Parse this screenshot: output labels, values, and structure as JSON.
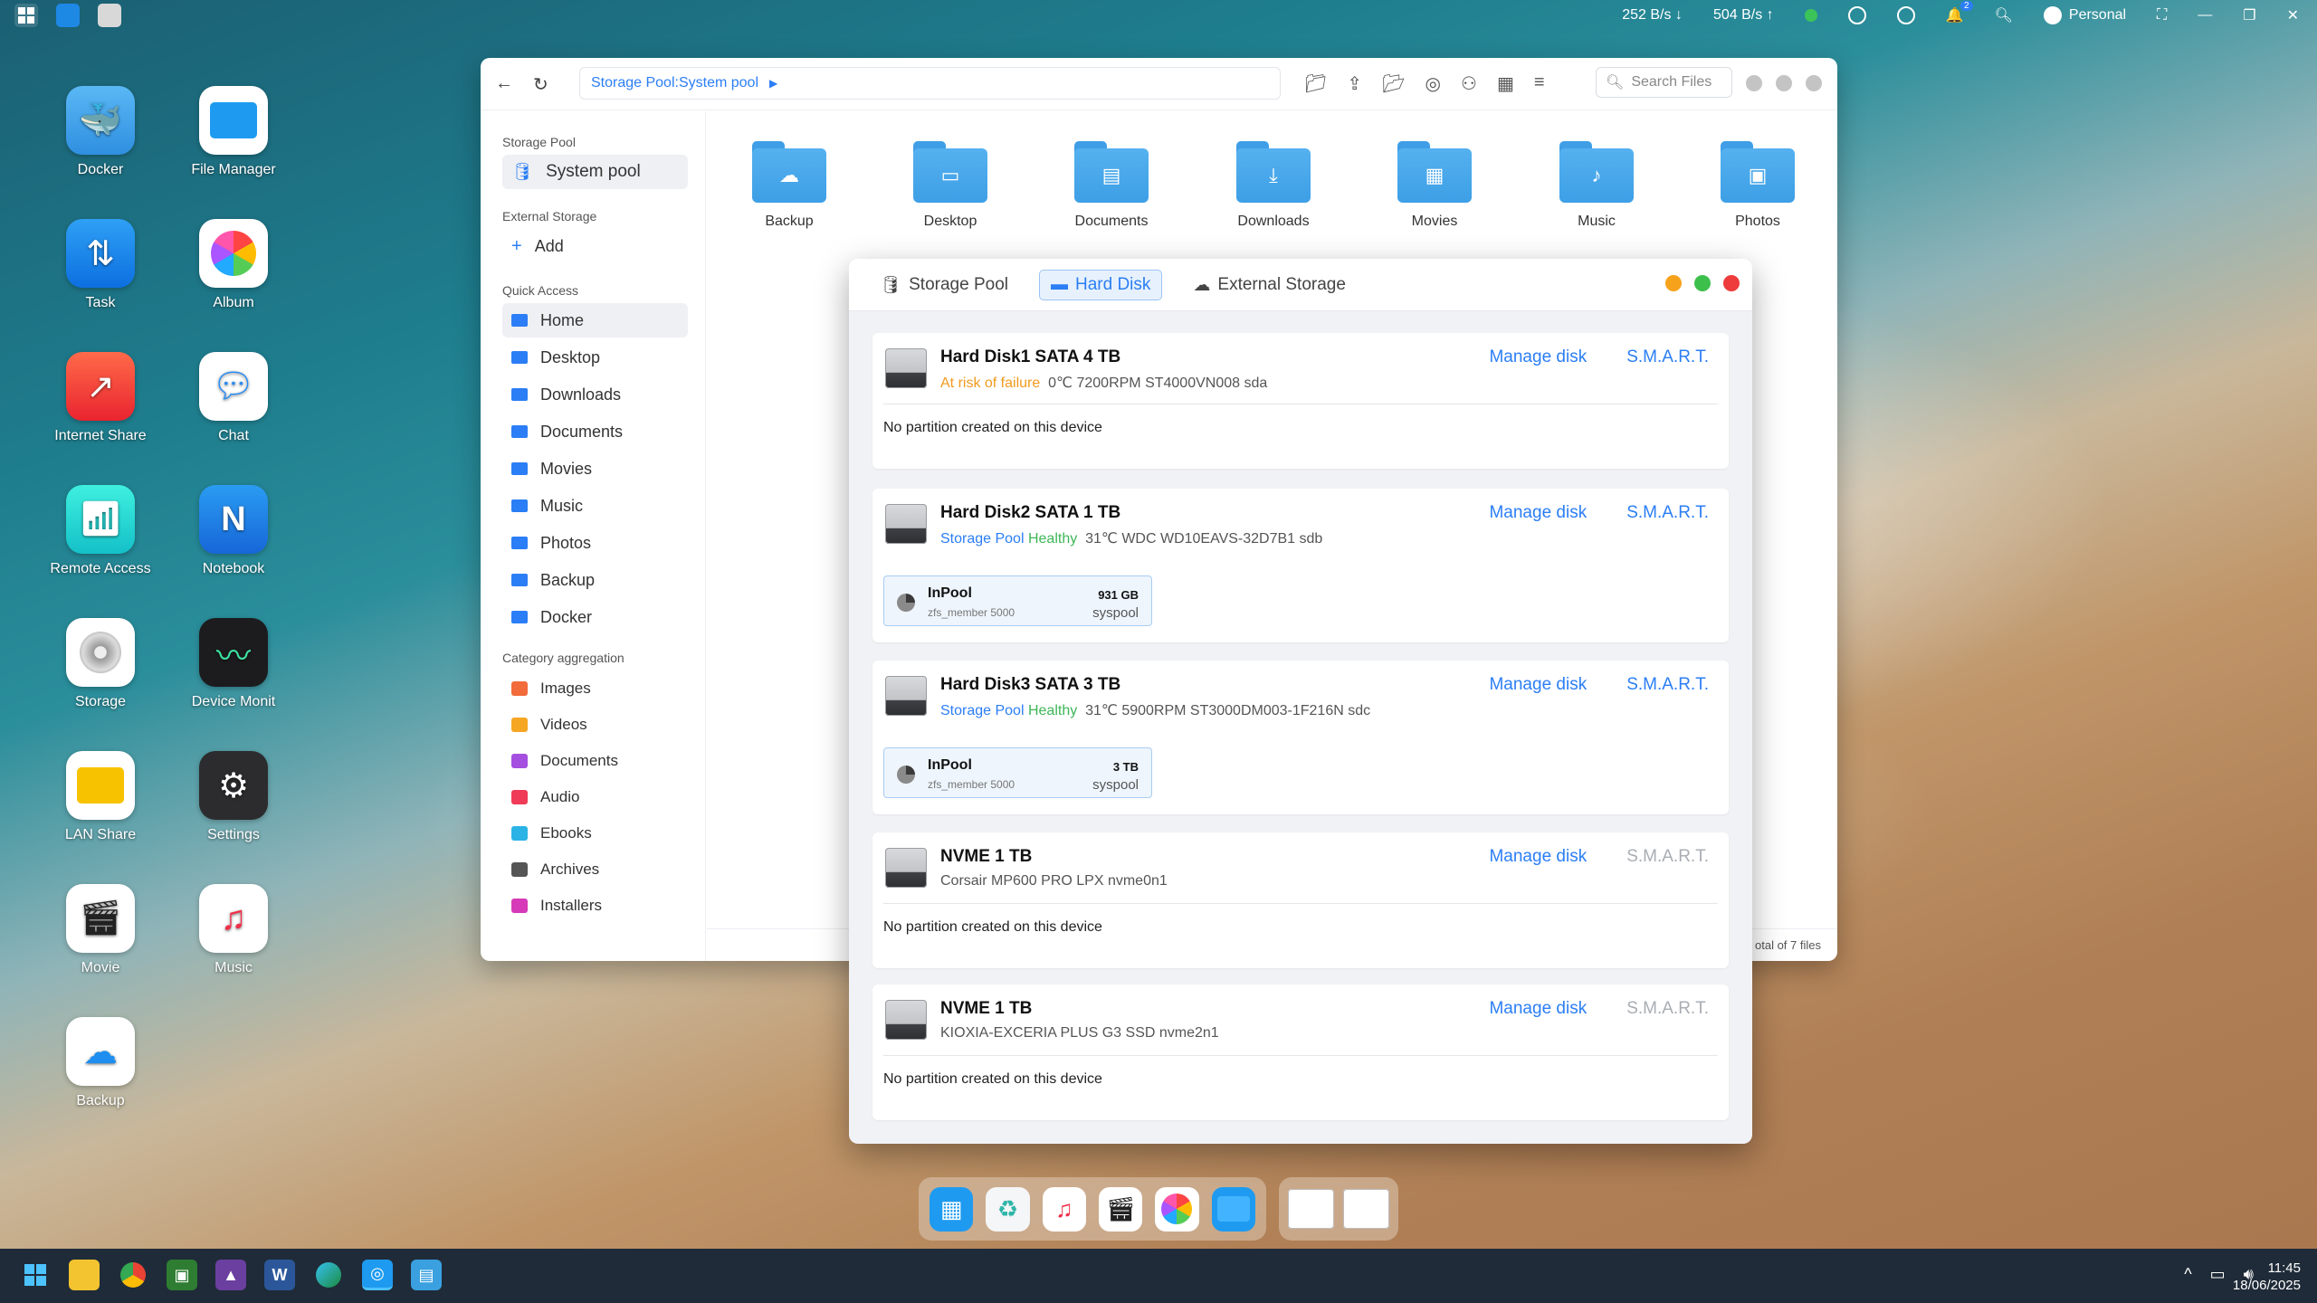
{
  "topbar": {
    "download_speed": "252 B/s",
    "upload_speed": "504 B/s",
    "user": "Personal"
  },
  "desktop_icons": [
    {
      "label": "Docker"
    },
    {
      "label": "File Manager"
    },
    {
      "label": "Task"
    },
    {
      "label": "Album"
    },
    {
      "label": "Internet Share"
    },
    {
      "label": "Chat"
    },
    {
      "label": "Remote Access"
    },
    {
      "label": "Notebook"
    },
    {
      "label": "Storage"
    },
    {
      "label": "Device Monit"
    },
    {
      "label": "LAN Share"
    },
    {
      "label": "Settings"
    },
    {
      "label": "Movie"
    },
    {
      "label": "Music"
    },
    {
      "label": "Backup"
    }
  ],
  "file_manager": {
    "path_text": "Storage Pool:System pool",
    "search_placeholder": "Search Files",
    "sidebar": {
      "storage_pool_header": "Storage Pool",
      "storage_pool_item": "System pool",
      "external_header": "External Storage",
      "external_add": "Add",
      "quick_header": "Quick Access",
      "quick_items": [
        "Home",
        "Desktop",
        "Downloads",
        "Documents",
        "Movies",
        "Music",
        "Photos",
        "Backup",
        "Docker"
      ],
      "category_header": "Category aggregation",
      "category_items": [
        "Images",
        "Videos",
        "Documents",
        "Audio",
        "Ebooks",
        "Archives",
        "Installers"
      ]
    },
    "folders": [
      "Backup",
      "Desktop",
      "Documents",
      "Downloads",
      "Movies",
      "Music",
      "Photos"
    ],
    "footer_text": "otal of 7 files"
  },
  "storage_window": {
    "tabs": [
      "Storage Pool",
      "Hard Disk",
      "External Storage"
    ],
    "manage_label": "Manage disk",
    "smart_label": "S.M.A.R.T.",
    "disks": [
      {
        "title": "Hard Disk1 SATA 4 TB",
        "status": "At risk of failure",
        "detail": "0℃  7200RPM  ST4000VN008  sda",
        "note": "No partition created on this device"
      },
      {
        "title": "Hard Disk2 SATA 1 TB",
        "pool": "Storage Pool",
        "health": "Healthy",
        "detail": "31℃  WDC WD10EAVS-32D7B1  sdb",
        "partition": {
          "name": "InPool",
          "type": "zfs_member 5000",
          "size": "931 GB",
          "pool": "syspool"
        }
      },
      {
        "title": "Hard Disk3 SATA 3 TB",
        "pool": "Storage Pool",
        "health": "Healthy",
        "detail": "31℃  5900RPM  ST3000DM003-1F216N  sdc",
        "partition": {
          "name": "InPool",
          "type": "zfs_member 5000",
          "size": "3 TB",
          "pool": "syspool"
        }
      },
      {
        "title": "NVME  1 TB",
        "detail": "Corsair MP600 PRO LPX  nvme0n1",
        "note": "No partition created on this device"
      },
      {
        "title": "NVME  1 TB",
        "detail": "KIOXIA-EXCERIA PLUS G3 SSD  nvme2n1",
        "note": "No partition created on this device"
      }
    ]
  },
  "taskbar": {
    "time": "11:45",
    "date": "18/06/2025"
  }
}
